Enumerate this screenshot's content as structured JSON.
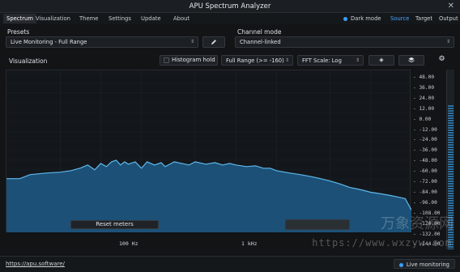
{
  "window": {
    "title": "APU Spectrum Analyzer",
    "close_glyph": "✕"
  },
  "tabs": [
    {
      "label": "Spectrum",
      "active": true
    },
    {
      "label": "Visualization",
      "active": false
    },
    {
      "label": "Theme",
      "active": false
    },
    {
      "label": "Settings",
      "active": false
    },
    {
      "label": "Update",
      "active": false
    },
    {
      "label": "About",
      "active": false
    }
  ],
  "topright": {
    "dark_mode": "Dark mode",
    "source": "Source",
    "target": "Target",
    "output": "Output"
  },
  "presets": {
    "label": "Presets",
    "value": "Live Monitoring - Full Range",
    "edit_icon": "pencil-icon"
  },
  "channel": {
    "label": "Channel mode",
    "value": "Channel-linked"
  },
  "viz": {
    "label": "Visualization",
    "histogram_hold": "Histogram hold",
    "range": "Full Range (>= -160)",
    "fft_scale": "FFT Scale: Log",
    "icons": [
      "diamond-icon",
      "layers-icon",
      "gear-icon"
    ]
  },
  "buttons": {
    "reset_meters": "Reset meters"
  },
  "freq_markers": [
    "100 Hz",
    "1 kHz"
  ],
  "footer": {
    "url": "https://apu.software/",
    "status": "Live monitoring"
  },
  "watermark": {
    "cn": "万象资源网",
    "url": "https://www.wxzyw.com"
  },
  "chart_data": {
    "type": "area",
    "xlabel": "",
    "ylabel": "",
    "x_scale": "log",
    "y_ticks": [
      48,
      36,
      24,
      12,
      0,
      -12,
      -24,
      -36,
      -48,
      -60,
      -72,
      -84,
      -96,
      -108,
      -120,
      -132,
      -144
    ],
    "ylim": [
      -150,
      52
    ],
    "colors": {
      "line": "#5fb8ec",
      "fill": "#1e5a86"
    },
    "x": [
      20,
      25,
      30,
      40,
      50,
      60,
      70,
      80,
      90,
      100,
      110,
      120,
      130,
      140,
      150,
      160,
      180,
      200,
      220,
      250,
      280,
      300,
      350,
      400,
      450,
      500,
      600,
      700,
      800,
      900,
      1000,
      1200,
      1400,
      1600,
      1800,
      2000,
      2500,
      3000,
      3500,
      4000,
      5000,
      6000,
      7000,
      8000,
      9000,
      10000,
      12000,
      14000,
      16000,
      18000,
      20000
    ],
    "y": [
      -83,
      -83,
      -78,
      -76,
      -75,
      -73,
      -70,
      -66,
      -72,
      -64,
      -68,
      -62,
      -60,
      -66,
      -62,
      -65,
      -62,
      -70,
      -62,
      -66,
      -63,
      -68,
      -62,
      -64,
      -66,
      -62,
      -65,
      -63,
      -66,
      -64,
      -66,
      -68,
      -67,
      -70,
      -70,
      -73,
      -76,
      -78,
      -80,
      -82,
      -86,
      -90,
      -94,
      -96,
      -98,
      -100,
      -102,
      -104,
      -106,
      -108,
      -122
    ]
  }
}
